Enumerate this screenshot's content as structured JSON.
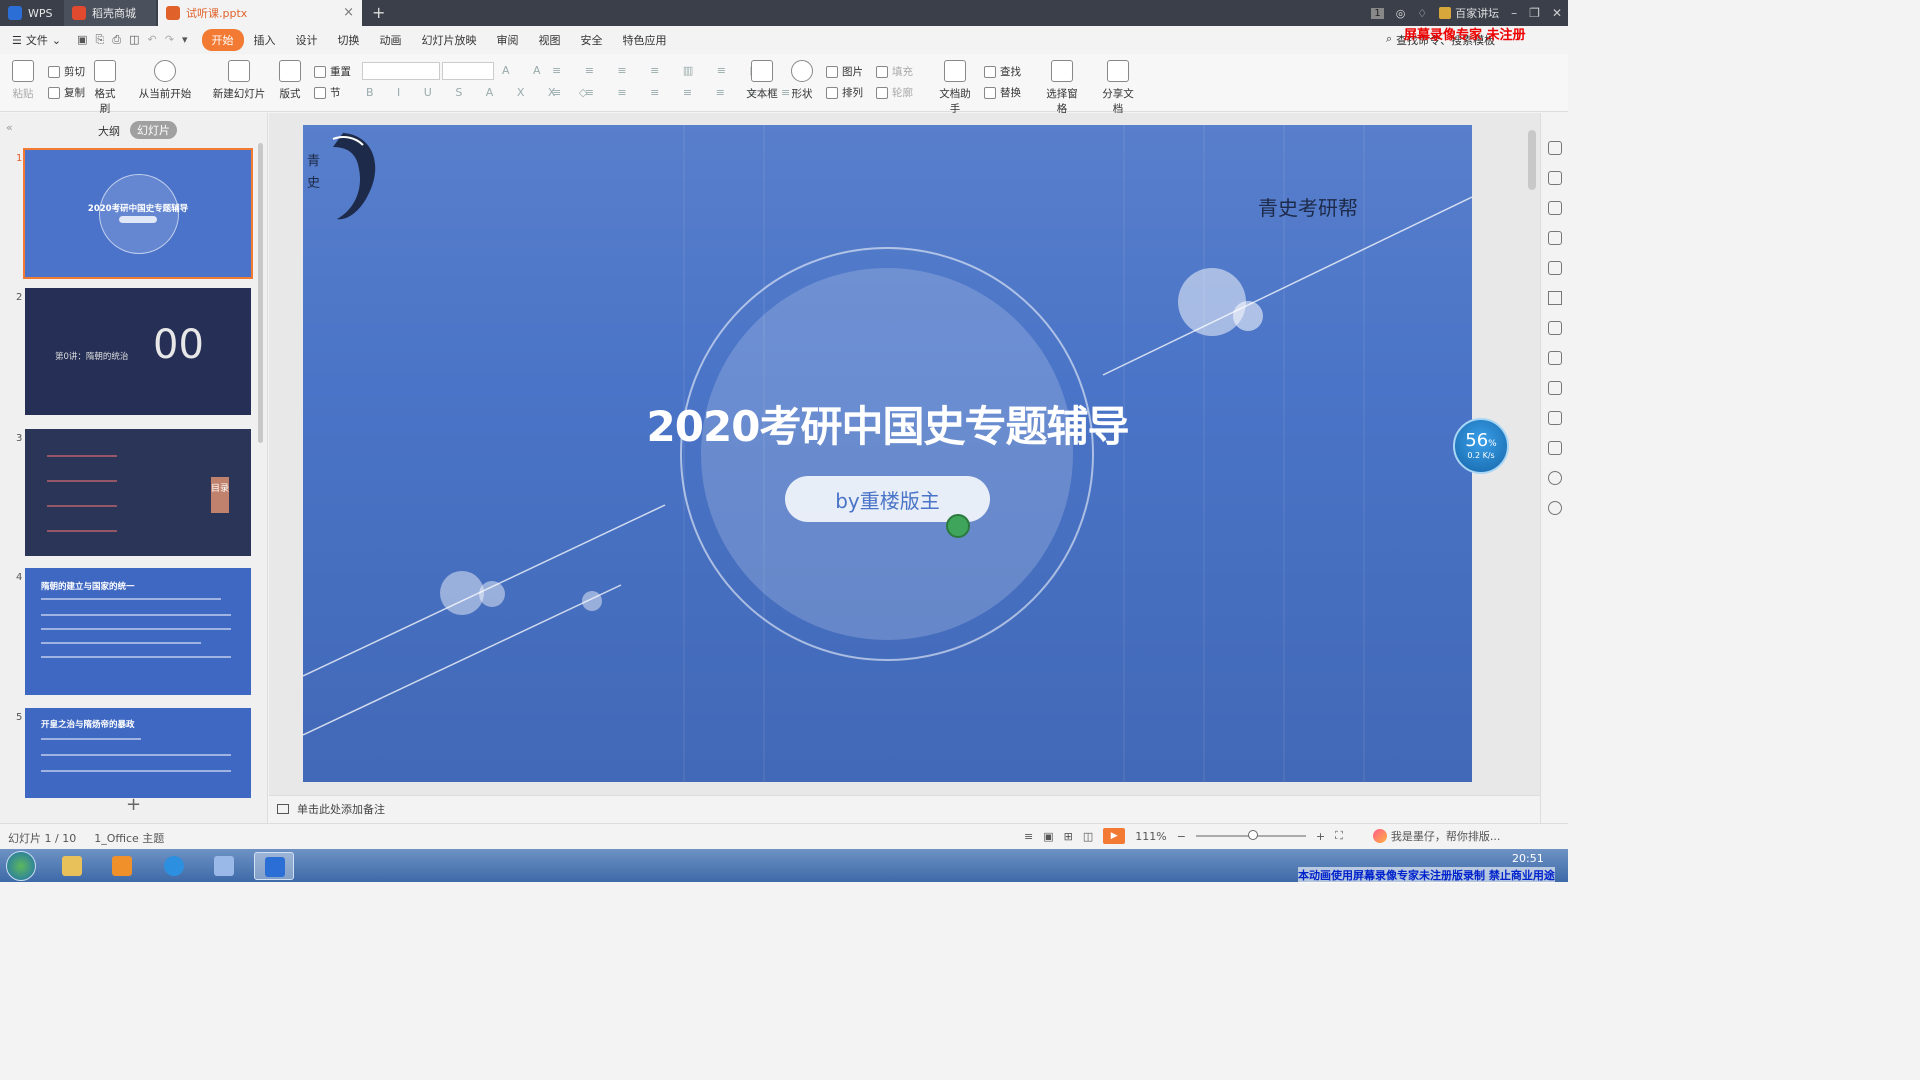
{
  "titlebar": {
    "tabs": [
      {
        "label": "WPS",
        "icon": "wps-logo-icon"
      },
      {
        "label": "稻壳商城",
        "icon": "docer-icon"
      },
      {
        "label": "试听课.pptx",
        "icon": "ppt-file-icon"
      }
    ],
    "badge": "1",
    "forum_label": "百家讲坛"
  },
  "watermark_top": "屏幕录像专家  未注册",
  "menu": {
    "file": "文件",
    "items": [
      "开始",
      "插入",
      "设计",
      "切换",
      "动画",
      "幻灯片放映",
      "审阅",
      "视图",
      "安全",
      "特色应用"
    ],
    "active": "开始",
    "search": "查找命令、搜索模板"
  },
  "ribbon": {
    "paste": "粘贴",
    "cut": "剪切",
    "copy": "复制",
    "format_painter": "格式刷",
    "from_current": "从当前开始",
    "new_slide": "新建幻灯片",
    "layout": "版式",
    "reset": "重置",
    "section": "节",
    "textbox": "文本框",
    "shape": "形状",
    "picture": "图片",
    "fill": "填充",
    "arrange": "排列",
    "outline": "轮廓",
    "doc_helper": "文档助手",
    "find": "查找",
    "replace": "替换",
    "select_pane": "选择窗格",
    "share": "分享文档"
  },
  "left_panel": {
    "outline_tab": "大纲",
    "slides_tab": "幻灯片",
    "thumbs": [
      {
        "num": "1",
        "title": "2020考研中国史专题辅导"
      },
      {
        "num": "2",
        "title": "第0讲：隋朝的统治",
        "big": "00"
      },
      {
        "num": "3",
        "title": "目录"
      },
      {
        "num": "4",
        "title": "隋朝的建立与国家的统一"
      },
      {
        "num": "5",
        "title": "开皇之治与隋炀帝的暴政"
      }
    ]
  },
  "slide": {
    "logo_text": "青史考研帮",
    "title": "2020考研中国史专题辅导",
    "subtitle": "by重楼版主"
  },
  "net_widget": {
    "percent": "56",
    "unit": "%",
    "speed": "0.2 K/s"
  },
  "notes": "单击此处添加备注",
  "status": {
    "slide_pos": "幻灯片 1 / 10",
    "theme": "1_Office 主题",
    "zoom": "111%",
    "assistant": "我是墨仔，帮你排版..."
  },
  "taskbar": {
    "clock": "20:51",
    "footer_watermark": "本动画使用屏幕录像专家未注册版录制  禁止商业用途"
  },
  "colors": {
    "accent": "#f27a33",
    "slide_bg": "#4a74c7",
    "titlebar": "#3a3f4a"
  }
}
